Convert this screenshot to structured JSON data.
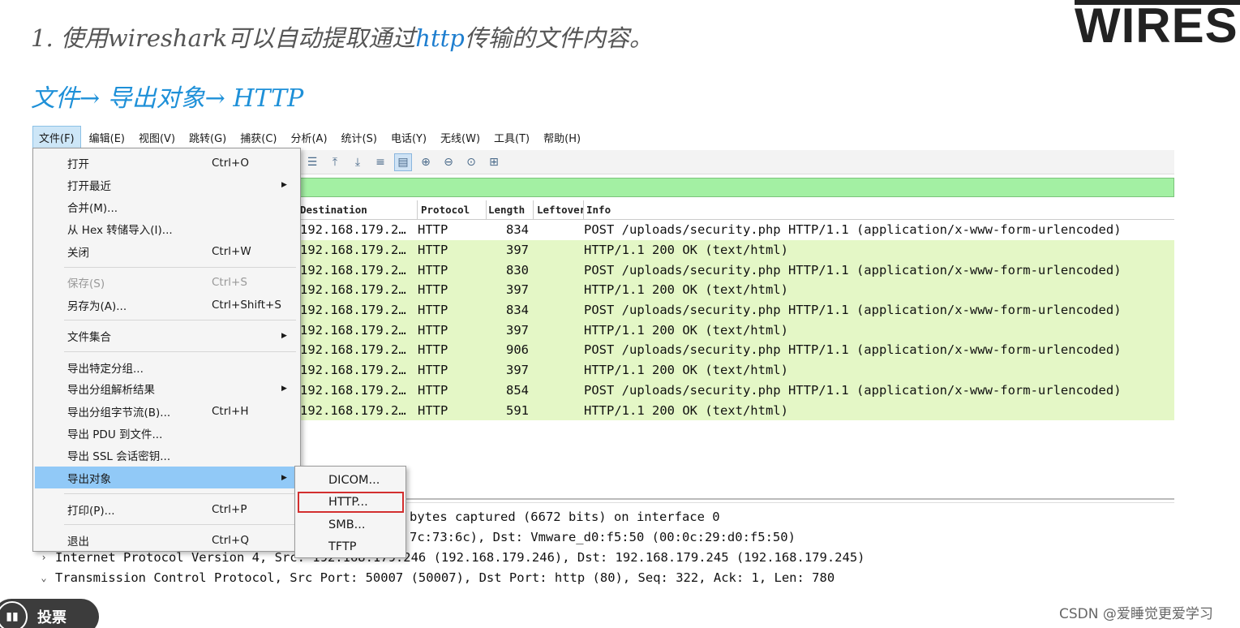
{
  "slide": {
    "heading_prefix": "1. 使用wireshark可以自动提取通过",
    "heading_highlight": "http",
    "heading_suffix": "传输的文件内容。",
    "logo_text": "WIRESH",
    "path_text": "文件→ 导出对象→ HTTP"
  },
  "menubar": [
    "文件(F)",
    "编辑(E)",
    "视图(V)",
    "跳转(G)",
    "捕获(C)",
    "分析(A)",
    "统计(S)",
    "电话(Y)",
    "无线(W)",
    "工具(T)",
    "帮助(H)"
  ],
  "packet_list": {
    "headers": {
      "destination": "Destination",
      "protocol": "Protocol",
      "length": "Length",
      "leftover": "Leftover",
      "info": "Info"
    },
    "rows": [
      {
        "dst": "192.168.179.2…",
        "proto": "HTTP",
        "len": "834",
        "info": "POST /uploads/security.php HTTP/1.1  (application/x-www-form-urlencoded)"
      },
      {
        "dst": "192.168.179.2…",
        "proto": "HTTP",
        "len": "397",
        "info": "HTTP/1.1 200 OK  (text/html)"
      },
      {
        "dst": "192.168.179.2…",
        "proto": "HTTP",
        "len": "830",
        "info": "POST /uploads/security.php HTTP/1.1  (application/x-www-form-urlencoded)"
      },
      {
        "dst": "192.168.179.2…",
        "proto": "HTTP",
        "len": "397",
        "info": "HTTP/1.1 200 OK  (text/html)"
      },
      {
        "dst": "192.168.179.2…",
        "proto": "HTTP",
        "len": "834",
        "info": "POST /uploads/security.php HTTP/1.1  (application/x-www-form-urlencoded)"
      },
      {
        "dst": "192.168.179.2…",
        "proto": "HTTP",
        "len": "397",
        "info": "HTTP/1.1 200 OK  (text/html)"
      },
      {
        "dst": "192.168.179.2…",
        "proto": "HTTP",
        "len": "906",
        "info": "POST /uploads/security.php HTTP/1.1  (application/x-www-form-urlencoded)"
      },
      {
        "dst": "192.168.179.2…",
        "proto": "HTTP",
        "len": "397",
        "info": "HTTP/1.1 200 OK  (text/html)"
      },
      {
        "dst": "192.168.179.2…",
        "proto": "HTTP",
        "len": "854",
        "info": "POST /uploads/security.php HTTP/1.1  (application/x-www-form-urlencoded)"
      },
      {
        "dst": "192.168.179.2…",
        "proto": "HTTP",
        "len": "591",
        "info": "HTTP/1.1 200 OK  (text/html)"
      }
    ]
  },
  "details": [
    {
      "arrow": "",
      "text": "bytes captured (6672 bits) on interface 0"
    },
    {
      "arrow": "",
      "text": "7c:73:6c), Dst: Vmware_d0:f5:50 (00:0c:29:d0:f5:50)"
    },
    {
      "arrow": "›",
      "text": "Internet Protocol Version 4, Src: 192.168.179.246 (192.168.179.246), Dst: 192.168.179.245 (192.168.179.245)"
    },
    {
      "arrow": "⌄",
      "text": "Transmission Control Protocol, Src Port: 50007 (50007), Dst Port: http (80), Seq: 322, Ack: 1, Len: 780"
    }
  ],
  "file_menu": {
    "open": {
      "label": "打开",
      "shortcut": "Ctrl+O"
    },
    "open_recent": {
      "label": "打开最近"
    },
    "merge": {
      "label": "合并(M)..."
    },
    "import_hex": {
      "label": "从 Hex 转储导入(I)..."
    },
    "close": {
      "label": "关闭",
      "shortcut": "Ctrl+W"
    },
    "save": {
      "label": "保存(S)",
      "shortcut": "Ctrl+S"
    },
    "save_as": {
      "label": "另存为(A)...",
      "shortcut": "Ctrl+Shift+S"
    },
    "file_set": {
      "label": "文件集合"
    },
    "export_specified": {
      "label": "导出特定分组..."
    },
    "export_dissections": {
      "label": "导出分组解析结果"
    },
    "export_bytes": {
      "label": "导出分组字节流(B)...",
      "shortcut": "Ctrl+H"
    },
    "export_pdu": {
      "label": "导出 PDU 到文件..."
    },
    "export_ssl": {
      "label": "导出 SSL 会话密钥..."
    },
    "export_objects": {
      "label": "导出对象"
    },
    "print": {
      "label": "打印(P)...",
      "shortcut": "Ctrl+P"
    },
    "quit": {
      "label": "退出",
      "shortcut": "Ctrl+Q"
    }
  },
  "export_objects_submenu": [
    "DICOM...",
    "HTTP...",
    "SMB...",
    "TFTP"
  ],
  "footer": {
    "vote_label": "投票",
    "watermark": "CSDN @爱睡觉更爱学习"
  },
  "colors": {
    "accent": "#1e90d8",
    "menu_highlight": "#91c9f7",
    "row_green": "#e4f7c6",
    "filter_green": "#a3f0a3",
    "box_red": "#d32f2f"
  }
}
